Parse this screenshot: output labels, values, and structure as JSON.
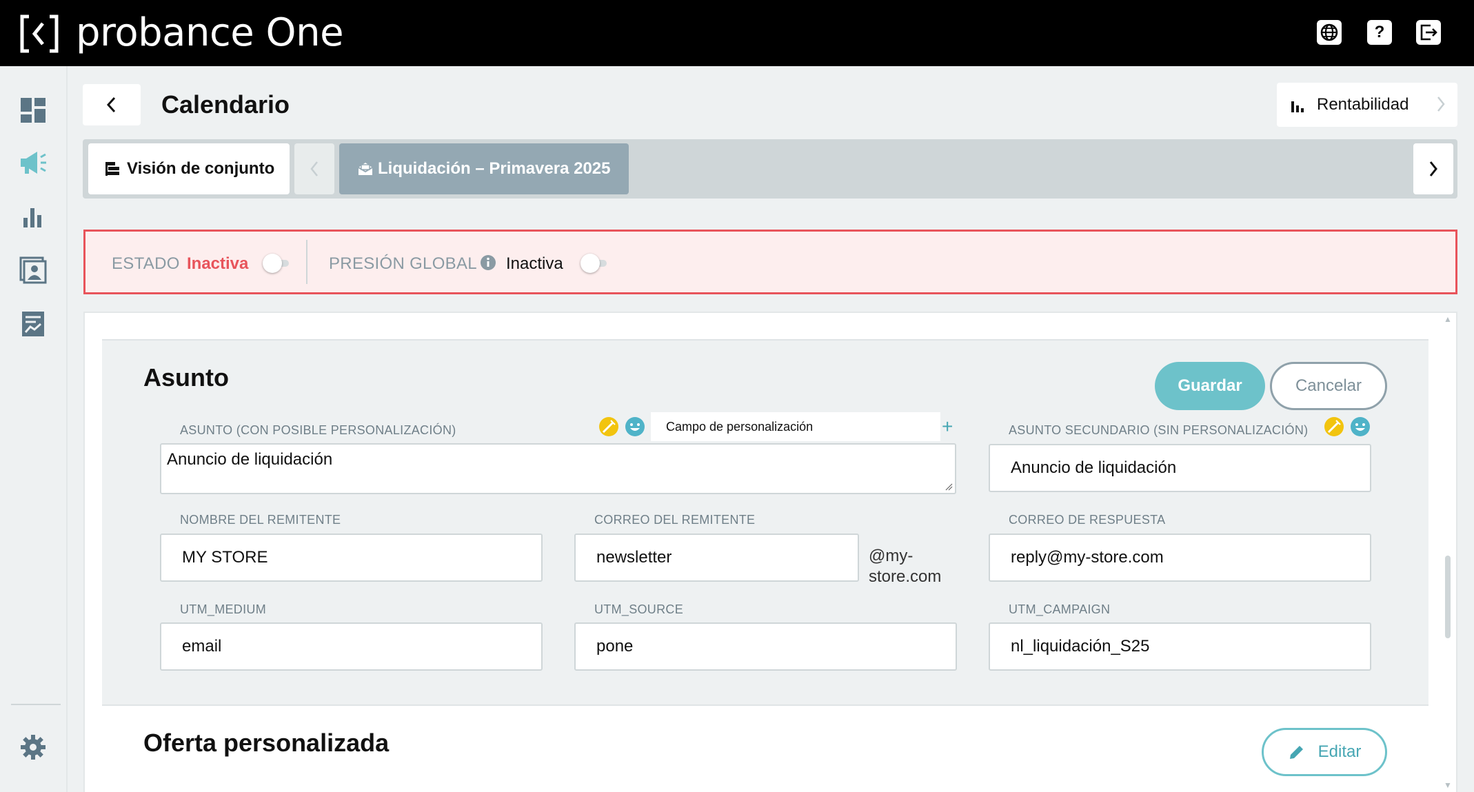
{
  "app": {
    "name": "probance One",
    "top_icons": [
      "globe-icon",
      "help-icon",
      "logout-icon"
    ],
    "help_glyph": "?"
  },
  "sidebar": {
    "items": [
      "dashboard-icon",
      "megaphone-icon",
      "bar-chart-icon",
      "contacts-icon",
      "report-icon"
    ],
    "settings": "gear-icon"
  },
  "header": {
    "title": "Calendario",
    "right_button": "Rentabilidad"
  },
  "tabs": {
    "overview": "Visión de conjunto",
    "active": "Liquidación – Primavera 2025"
  },
  "status": {
    "estado_label": "ESTADO",
    "estado_value": "Inactiva",
    "presion_label": "PRESIÓN GLOBAL",
    "presion_value": "Inactiva",
    "estado_on": false,
    "presion_on": false
  },
  "asunto": {
    "title": "Asunto",
    "save": "Guardar",
    "cancel": "Cancelar",
    "perso_placeholder": "Campo de personalización",
    "plus": "+",
    "fields": {
      "subject_label": "ASUNTO (CON POSIBLE PERSONALIZACIÓN)",
      "subject_value": "Anuncio de liquidación",
      "secondary_label": "ASUNTO SECUNDARIO (SIN PERSONALIZACIÓN)",
      "secondary_value": "Anuncio de liquidación",
      "sender_name_label": "NOMBRE DEL REMITENTE",
      "sender_name_value": "MY STORE",
      "sender_email_label": "CORREO DEL REMITENTE",
      "sender_email_value": "newsletter",
      "sender_email_domain": "@my-store.com",
      "reply_label": "CORREO DE RESPUESTA",
      "reply_value": "reply@my-store.com",
      "utm_medium_label": "UTM_MEDIUM",
      "utm_medium_value": "email",
      "utm_source_label": "UTM_SOURCE",
      "utm_source_value": "pone",
      "utm_campaign_label": "UTM_CAMPAIGN",
      "utm_campaign_value": "nl_liquidación_S25"
    }
  },
  "oferta": {
    "title": "Oferta personalizada",
    "edit": "Editar"
  },
  "colors": {
    "accent": "#6dc2ca",
    "danger": "#e8545b",
    "tab_active": "#94a8b3",
    "sidebar_icon": "#5b7585",
    "sidebar_icon_active": "#6dc2ca",
    "emoji_yellow": "#f2c40f",
    "emoji_blue": "#4fb3c8"
  }
}
